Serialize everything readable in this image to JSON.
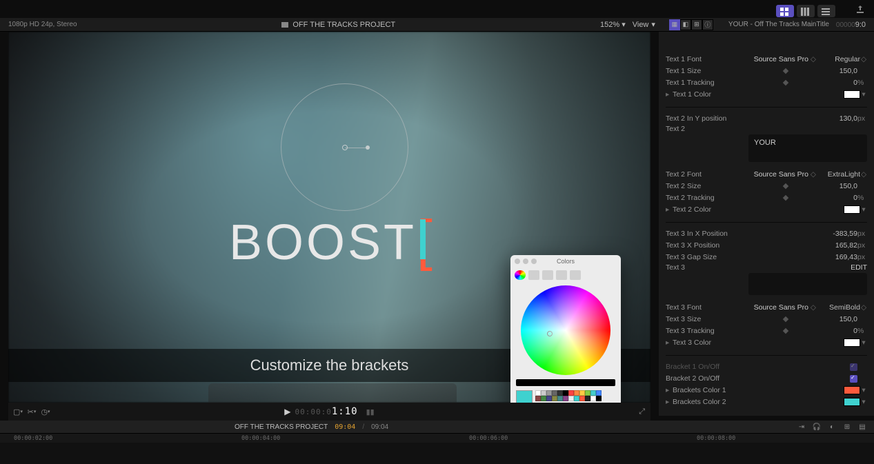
{
  "top_right": {
    "mode1": "grid",
    "mode2": "cols",
    "mode3": "list",
    "share": "share"
  },
  "header": {
    "format": "1080p HD 24p, Stereo",
    "project": "OFF THE TRACKS PROJECT",
    "zoom": "152%",
    "view_label": "View",
    "clip_name": "YOUR - Off The Tracks MainTitle",
    "timecode_small": "00000",
    "timecode_big": "9:0"
  },
  "viewer": {
    "title_text": "BOOST",
    "bracket": "[",
    "caption": "Customize the brackets"
  },
  "transport": {
    "timecode_grey": "00:00:0",
    "timecode_white": "1:10",
    "playback_tc": "00:00:01:10"
  },
  "timeline_header": {
    "project": "OFF THE TRACKS PROJECT",
    "cur": "09:04",
    "total": "09:04"
  },
  "ruler": {
    "t1": "00:00:02:00",
    "t2": "00:00:04:00",
    "t3": "00:00:06:00",
    "t4": "00:00:08:00"
  },
  "color_popup": {
    "title": "Colors"
  },
  "inspector": {
    "text1": {
      "font_label": "Text 1 Font",
      "font_name": "Source Sans Pro",
      "font_style": "Regular",
      "size_label": "Text 1 Size",
      "size_value": "150,0",
      "tracking_label": "Text 1 Tracking",
      "tracking_value": "0",
      "tracking_unit": "%",
      "color_label": "Text 1 Color"
    },
    "text2": {
      "ypos_label": "Text 2 In Y position",
      "ypos_value": "130,0",
      "ypos_unit": "px",
      "text_label": "Text 2",
      "text_value": "YOUR",
      "font_label": "Text 2 Font",
      "font_name": "Source Sans Pro",
      "font_style": "ExtraLight",
      "size_label": "Text 2 Size",
      "size_value": "150,0",
      "tracking_label": "Text 2 Tracking",
      "tracking_value": "0",
      "tracking_unit": "%",
      "color_label": "Text 2 Color"
    },
    "text3": {
      "inx_label": "Text 3 In X Position",
      "inx_value": "-383,59",
      "x_label": "Text 3 X Position",
      "x_value": "165,82",
      "gap_label": "Text 3 Gap Size",
      "gap_value": "169,43",
      "unit_px": "px",
      "text_label": "Text 3",
      "text_value": "EDIT",
      "font_label": "Text 3 Font",
      "font_name": "Source Sans Pro",
      "font_style": "SemiBold",
      "size_label": "Text 3 Size",
      "size_value": "150,0",
      "tracking_label": "Text 3 Tracking",
      "tracking_value": "0",
      "tracking_unit": "%",
      "color_label": "Text 3 Color"
    },
    "brackets": {
      "b1_onoff": "Bracket 1 On/Off",
      "b2_onoff": "Bracket 2 On/Off",
      "c1_label": "Brackets Color 1",
      "c2_label": "Brackets Color 2"
    }
  }
}
